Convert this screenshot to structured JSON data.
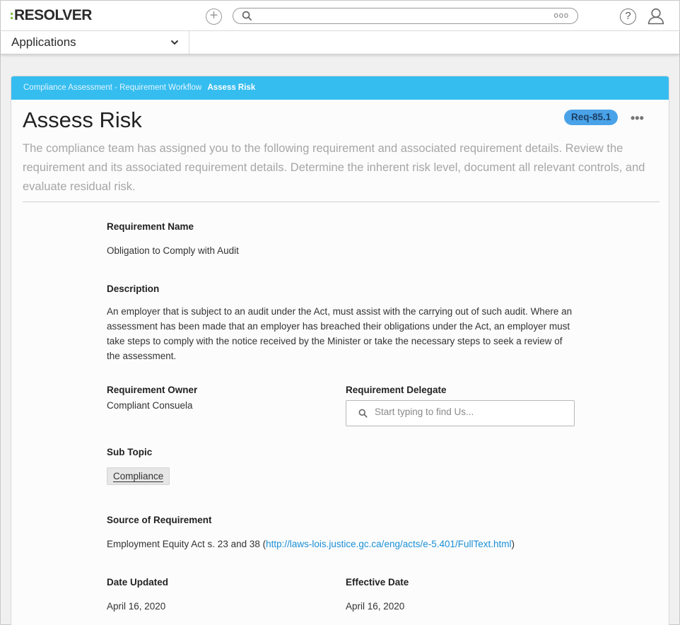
{
  "topbar": {
    "logo_text": "RESOLVER",
    "add_label": "+",
    "search_placeholder": "",
    "search_options": "ooo",
    "help_label": "?"
  },
  "appbar": {
    "app_select_label": "Applications"
  },
  "breadcrumb": {
    "parent": "Compliance Assessment - Requirement Workflow",
    "current": "Assess Risk"
  },
  "page": {
    "title": "Assess Risk",
    "badge": "Req-85.1",
    "more": "•••",
    "intro": "The compliance team has assigned you to the following requirement and associated requirement details. Review the requirement and its associated requirement details. Determine the inherent risk level, document all relevant controls, and evaluate residual risk."
  },
  "fields": {
    "requirement_name_label": "Requirement Name",
    "requirement_name_value": "Obligation to Comply with Audit",
    "description_label": "Description",
    "description_value": "An employer that is subject to an audit under the Act, must assist with the carrying out of such audit. Where an assessment has been made that an employer has breached their obligations under the Act, an employer must take steps to comply with the notice received by the Minister or take the necessary steps to seek a review of the assessment.",
    "owner_label": "Requirement Owner",
    "owner_value": "Compliant Consuela",
    "delegate_label": "Requirement Delegate",
    "delegate_placeholder": "Start typing to find Us...",
    "delegate_value": "",
    "subtopic_label": "Sub Topic",
    "subtopic_tag": "Compliance",
    "source_label": "Source of Requirement",
    "source_text": "Employment Equity Act s. 23 and 38 (",
    "source_link": "http://laws-lois.justice.gc.ca/eng/acts/e-5.401/FullText.html",
    "source_close": ")",
    "date_updated_label": "Date Updated",
    "date_updated_value": "April 16, 2020",
    "effective_date_label": "Effective Date",
    "effective_date_value": "April 16, 2020"
  },
  "colors": {
    "breadcrumb_bg": "#35bdf0",
    "badge_bg": "#4aa3e8",
    "logo_accent": "#7ac142",
    "link": "#1a8fd6"
  },
  "icons": {
    "add": "plus-circle-icon",
    "search": "search-icon",
    "search_options": "more-horizontal-icon",
    "help": "help-icon",
    "user": "user-icon",
    "app_select": "chevron-down-icon",
    "delegate_search": "search-icon"
  }
}
